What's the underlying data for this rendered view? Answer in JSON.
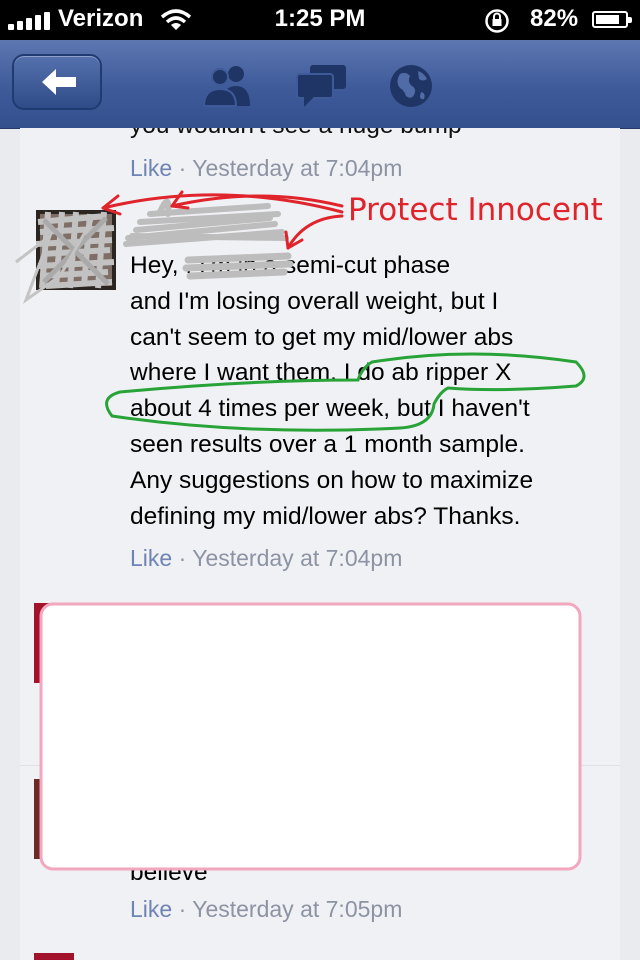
{
  "status_bar": {
    "carrier": "Verizon",
    "time": "1:25 PM",
    "battery_percent": "82%",
    "battery_level": 0.82
  },
  "nav": {
    "back_icon": "back-arrow-icon",
    "icons": [
      "friends-icon",
      "messages-icon",
      "notifications-globe-icon"
    ]
  },
  "comments": [
    {
      "text_partial": "you wouldn't see a huge bump",
      "like_label": "Like",
      "separator": " · ",
      "timestamp": "Yesterday at 7:04pm"
    },
    {
      "lines": [
        "Hey,        . I'm in a semi-cut phase",
        "and I'm losing overall weight, but I",
        "can't seem to get my mid/lower abs",
        "where I want them. I do ab ripper X",
        "about 4 times per week, but I haven't",
        "seen results over a 1 month sample.",
        "Any suggestions on how to maximize",
        "defining my mid/lower abs? Thanks."
      ],
      "like_label": "Like",
      "separator": " · ",
      "timestamp": "Yesterday at 7:04pm"
    },
    {
      "text_partial": "believe",
      "like_label": "Like",
      "separator": " · ",
      "timestamp": "Yesterday at 7:05pm"
    }
  ],
  "annotation": {
    "label": "Protect Innocent",
    "red_color": "#e0242b",
    "green_color": "#27a337",
    "redaction_box_border": "#f2a7be"
  }
}
